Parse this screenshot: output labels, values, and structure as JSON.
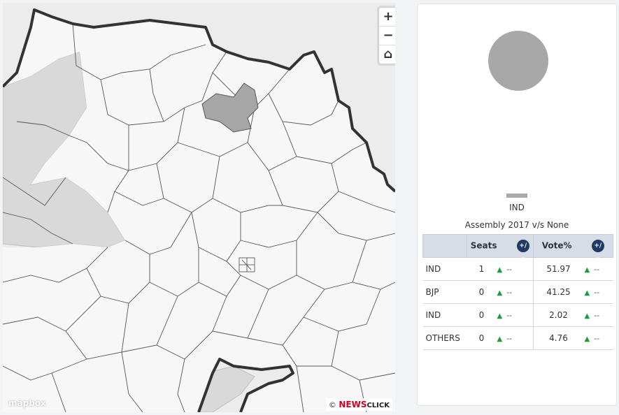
{
  "map": {
    "zoom_in_label": "+",
    "zoom_out_label": "−",
    "home_label": "⌂",
    "mapbox_label": "mapbox",
    "attribution_prefix": "©",
    "attribution_brand": "NEWS",
    "attribution_brand2": "CLICK",
    "colors": {
      "background": "#ececec",
      "constituency_fill": "#f7f7f7",
      "selected_fill": "#a6a6a6",
      "neighbour_fill": "#d9d9d9",
      "state_border": "#333333"
    }
  },
  "panel": {
    "pie": {
      "slices": [
        {
          "label": "IND",
          "value": 100,
          "color": "#a8a8a8"
        }
      ]
    },
    "legend": [
      {
        "label": "IND",
        "color": "#a8a8a8"
      }
    ],
    "table_title": "Assembly 2017 v/s None",
    "headers": {
      "party": "",
      "seats": "Seats",
      "vote": "Vote%",
      "change_icon": "+/−"
    },
    "rows": [
      {
        "party": "IND",
        "seats": "1",
        "seats_change": "--",
        "vote": "51.97",
        "vote_change": "--"
      },
      {
        "party": "BJP",
        "seats": "0",
        "seats_change": "--",
        "vote": "41.25",
        "vote_change": "--"
      },
      {
        "party": "IND",
        "seats": "0",
        "seats_change": "--",
        "vote": "2.02",
        "vote_change": "--"
      },
      {
        "party": "OTHERS",
        "seats": "0",
        "seats_change": "--",
        "vote": "4.76",
        "vote_change": "--"
      }
    ],
    "arrow_glyph": "▲"
  }
}
